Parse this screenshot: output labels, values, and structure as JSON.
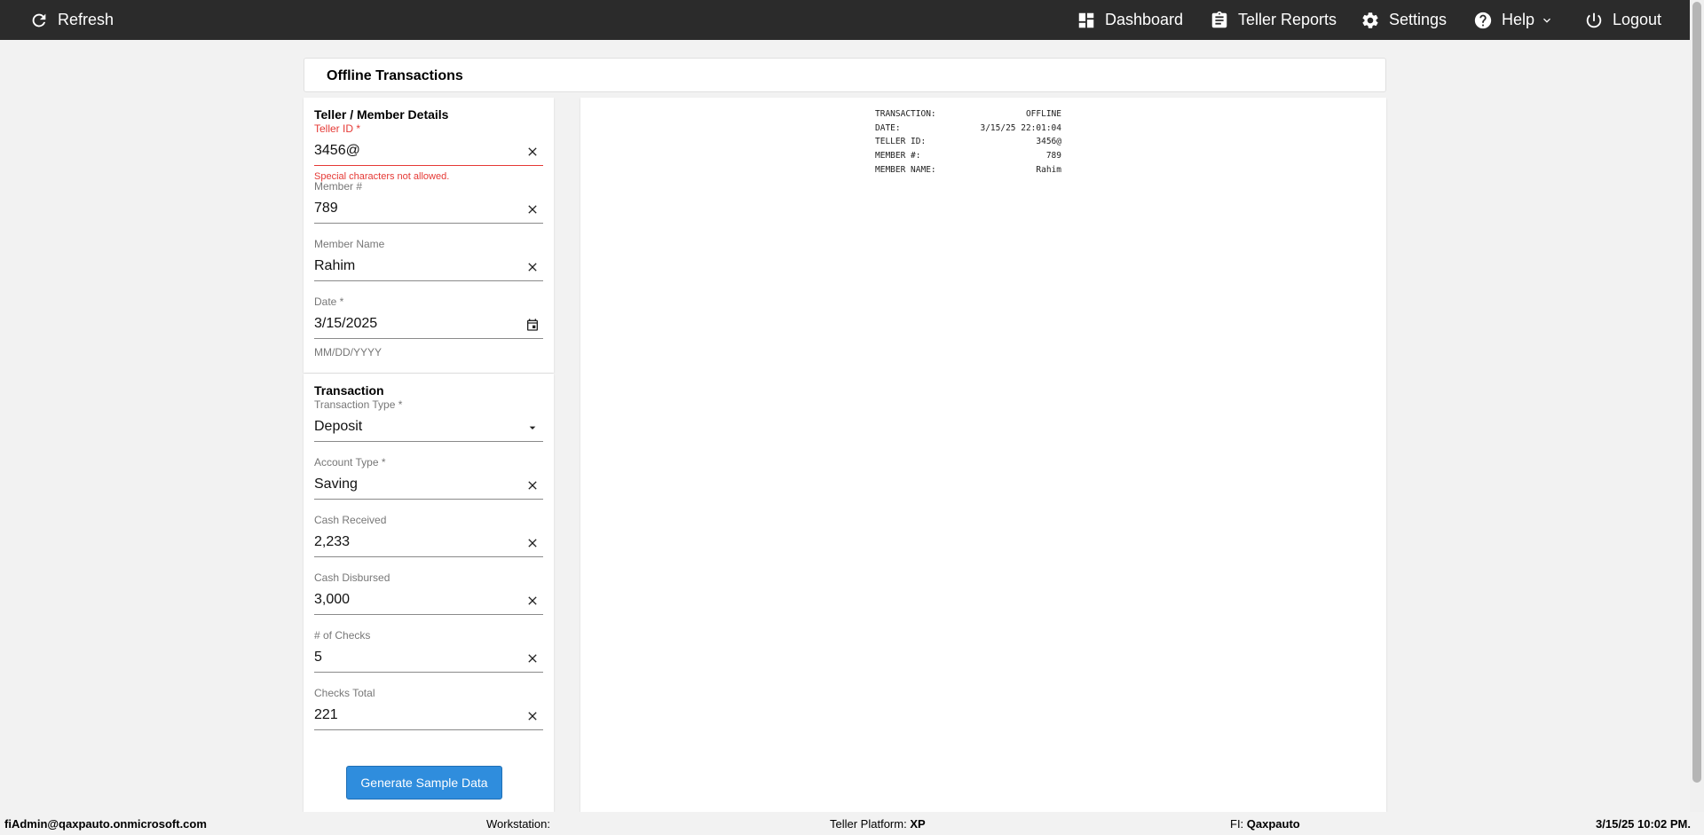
{
  "topbar": {
    "refresh": "Refresh",
    "dashboard": "Dashboard",
    "teller_reports": "Teller Reports",
    "settings": "Settings",
    "help": "Help",
    "logout": "Logout"
  },
  "page_title": "Offline Transactions",
  "teller_member": {
    "title": "Teller / Member Details",
    "teller_id": {
      "label": "Teller ID *",
      "value": "3456@",
      "error": "Special characters not allowed."
    },
    "member_number": {
      "label": "Member #",
      "value": "789"
    },
    "member_name": {
      "label": "Member Name",
      "value": "Rahim"
    },
    "date": {
      "label": "Date *",
      "value": "3/15/2025",
      "hint": "MM/DD/YYYY"
    }
  },
  "transaction": {
    "title": "Transaction",
    "transaction_type": {
      "label": "Transaction Type *",
      "value": "Deposit"
    },
    "account_type": {
      "label": "Account Type *",
      "value": "Saving"
    },
    "cash_received": {
      "label": "Cash Received",
      "value": "2,233"
    },
    "cash_disbursed": {
      "label": "Cash Disbursed",
      "value": "3,000"
    },
    "num_checks": {
      "label": "# of Checks",
      "value": "5"
    },
    "checks_total": {
      "label": "Checks Total",
      "value": "221"
    },
    "generate_button": "Generate Sample Data"
  },
  "receipt": {
    "lines": [
      {
        "key": "TRANSACTION:",
        "value": "OFFLINE"
      },
      {
        "key": "DATE:",
        "value": "3/15/25 22:01:04"
      },
      {
        "key": "TELLER ID:",
        "value": "3456@"
      },
      {
        "key": "MEMBER #:",
        "value": "789"
      },
      {
        "key": "MEMBER NAME:",
        "value": "Rahim"
      }
    ]
  },
  "statusbar": {
    "user": "fiAdmin@qaxpauto.onmicrosoft.com",
    "workstation_label": "Workstation:",
    "platform_label": "Teller Platform:",
    "platform_value": "XP",
    "fi_label": "FI:",
    "fi_value": "Qaxpauto",
    "datetime": "3/15/25 10:02 PM."
  },
  "colors": {
    "topbar_bg": "#2b2b2b",
    "error": "#e53935",
    "primary_button": "#2f8ddd"
  }
}
